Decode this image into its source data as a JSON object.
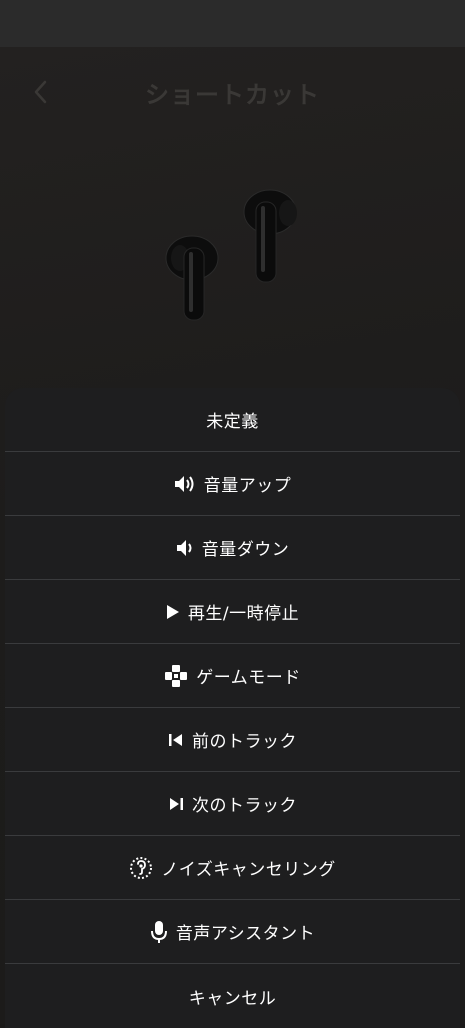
{
  "header": {
    "title": "ショートカット"
  },
  "sheet": {
    "options": [
      {
        "label": "未定義",
        "icon": "none"
      },
      {
        "label": "音量アップ",
        "icon": "volume-up-icon"
      },
      {
        "label": "音量ダウン",
        "icon": "volume-down-icon"
      },
      {
        "label": "再生/一時停止",
        "icon": "play-icon"
      },
      {
        "label": "ゲームモード",
        "icon": "gamepad-icon"
      },
      {
        "label": "前のトラック",
        "icon": "previous-track-icon"
      },
      {
        "label": "次のトラック",
        "icon": "next-track-icon"
      },
      {
        "label": "ノイズキャンセリング",
        "icon": "noise-cancelling-icon"
      },
      {
        "label": "音声アシスタント",
        "icon": "microphone-icon"
      },
      {
        "label": "キャンセル",
        "icon": "none"
      }
    ]
  },
  "colors": {
    "background": "#1b1a19",
    "sheet": "#1e1e1f",
    "divider": "#3a3b3d",
    "text": "#ffffff"
  }
}
